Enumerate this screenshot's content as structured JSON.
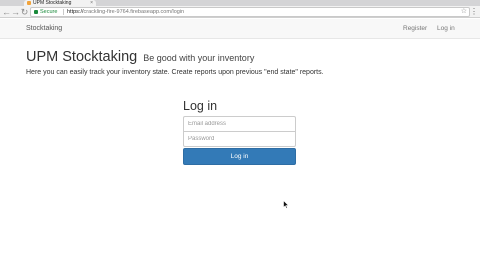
{
  "browser": {
    "tab_title": "UPM Stocktaking",
    "close_glyph": "×",
    "back_glyph": "←",
    "forward_glyph": "→",
    "reload_glyph": "↻",
    "security_label": "Secure",
    "url_scheme": "https://",
    "url_rest": "crackling-fire-9764.firebaseapp.com/login",
    "star_glyph": "☆",
    "menu_glyph": "⋮"
  },
  "navbar": {
    "brand": "Stocktaking",
    "links": [
      "Register",
      "Log in"
    ]
  },
  "hero": {
    "title": "UPM Stocktaking",
    "subtitle": "Be good with your inventory",
    "description": "Here you can easily track your inventory state. Create reports upon previous \"end state\" reports."
  },
  "login": {
    "heading": "Log in",
    "email_placeholder": "Email address",
    "password_placeholder": "Password",
    "submit_label": "Log in"
  },
  "colors": {
    "primary": "#337ab7",
    "secure_green": "#1a8a3b",
    "navbar_bg": "#f8f8f8"
  }
}
